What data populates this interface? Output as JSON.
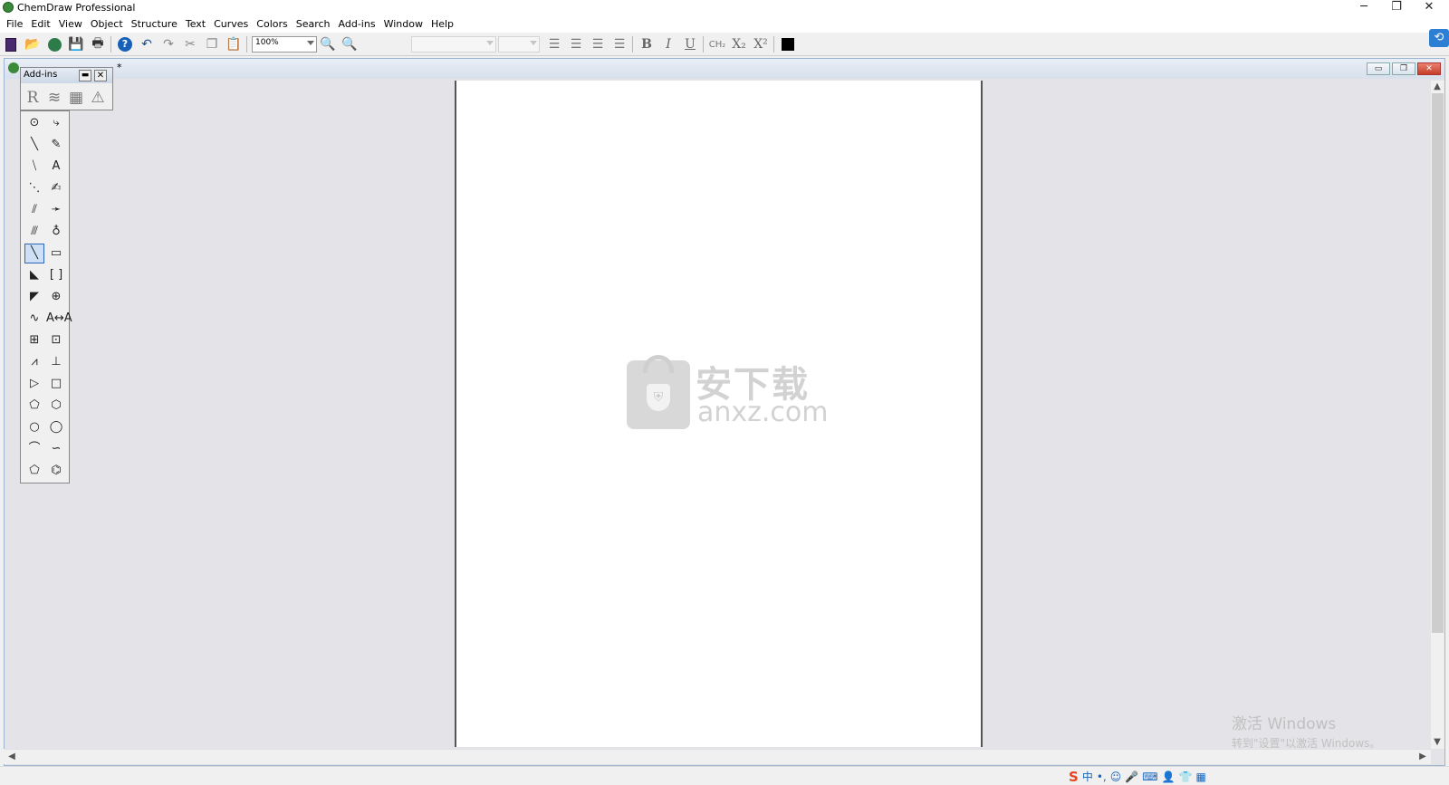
{
  "window": {
    "title": "ChemDraw Professional",
    "minimize": "─",
    "restore": "❐",
    "close": "✕"
  },
  "menubar": {
    "items": [
      "File",
      "Edit",
      "View",
      "Object",
      "Structure",
      "Text",
      "Curves",
      "Colors",
      "Search",
      "Add-ins",
      "Window",
      "Help"
    ]
  },
  "toolbar": {
    "zoom_value": "100%",
    "format": {
      "bold": "B",
      "italic": "I",
      "underline": "U",
      "formula": "CH₂",
      "subscript": "X₂",
      "superscript": "X²"
    },
    "icons": [
      "new-document-icon",
      "open-icon",
      "open-web-icon",
      "save-icon",
      "print-icon",
      "help-icon",
      "undo-icon",
      "redo-icon",
      "cut-icon",
      "copy-icon",
      "paste-icon",
      "zoom-in-icon",
      "zoom-out-icon",
      "align-left-icon",
      "align-center-icon",
      "align-right-icon",
      "justify-icon",
      "color-swatch-icon"
    ]
  },
  "document": {
    "title": "*"
  },
  "addins_palette": {
    "title": "Add-ins",
    "tools": [
      "R",
      "≋",
      "▦",
      "⚠"
    ]
  },
  "tools_palette": {
    "tools": [
      {
        "name": "lasso-tool",
        "glyph": "⊙"
      },
      {
        "name": "chain-tool",
        "glyph": "⤷"
      },
      {
        "name": "solid-bond-tool",
        "glyph": "╲"
      },
      {
        "name": "eraser-tool",
        "glyph": "✎"
      },
      {
        "name": "bold-bond-tool",
        "glyph": "⧹"
      },
      {
        "name": "text-tool",
        "glyph": "A"
      },
      {
        "name": "dashed-bond-tool",
        "glyph": "⋱"
      },
      {
        "name": "pen-tool",
        "glyph": "✍"
      },
      {
        "name": "hashed-bond-tool",
        "glyph": "⫽"
      },
      {
        "name": "arrow-tool",
        "glyph": "➛"
      },
      {
        "name": "hashed-wedge-tool",
        "glyph": "⫻"
      },
      {
        "name": "orbital-tool",
        "glyph": "♁"
      },
      {
        "name": "wedge-bond-tool",
        "glyph": "╲"
      },
      {
        "name": "drawing-elements-tool",
        "glyph": "▭"
      },
      {
        "name": "bold-wedge-tool",
        "glyph": "◣"
      },
      {
        "name": "brackets-tool",
        "glyph": "[ ]"
      },
      {
        "name": "hollow-wedge-tool",
        "glyph": "◤"
      },
      {
        "name": "chemical-symbols-tool",
        "glyph": "⊕"
      },
      {
        "name": "wavy-bond-tool",
        "glyph": "∿"
      },
      {
        "name": "query-tool",
        "glyph": "A↔A"
      },
      {
        "name": "table-tool",
        "glyph": "⊞"
      },
      {
        "name": "tlc-tool",
        "glyph": "⊡"
      },
      {
        "name": "spectrum-tool",
        "glyph": "⩘"
      },
      {
        "name": "template-tool",
        "glyph": "⊥"
      },
      {
        "name": "play-tool",
        "glyph": "▷"
      },
      {
        "name": "square-tool",
        "glyph": "□"
      },
      {
        "name": "pentagon-tool",
        "glyph": "⬠"
      },
      {
        "name": "hexagon-tool",
        "glyph": "⬡"
      },
      {
        "name": "cyclohexane-tool",
        "glyph": "○"
      },
      {
        "name": "cycloheptane-tool",
        "glyph": "◯"
      },
      {
        "name": "cyclohexane-chair-1-tool",
        "glyph": "⌒"
      },
      {
        "name": "cyclohexane-chair-2-tool",
        "glyph": "∽"
      },
      {
        "name": "cyclopentadiene-tool",
        "glyph": "⬠"
      },
      {
        "name": "benzene-tool",
        "glyph": "⌬"
      }
    ]
  },
  "watermark": {
    "cn": "安下载",
    "en": "anxz.com"
  },
  "activation": {
    "title": "激活 Windows",
    "subtitle": "转到\"设置\"以激活 Windows。"
  },
  "ime": {
    "logo": "S",
    "items": [
      "中",
      "•,",
      "☺",
      "🎤",
      "⌨",
      "👤",
      "👕",
      "▦"
    ]
  },
  "colors": {
    "accent": "#2d7fd4",
    "mdi_background": "#e4e4e8",
    "page": "#ffffff"
  }
}
